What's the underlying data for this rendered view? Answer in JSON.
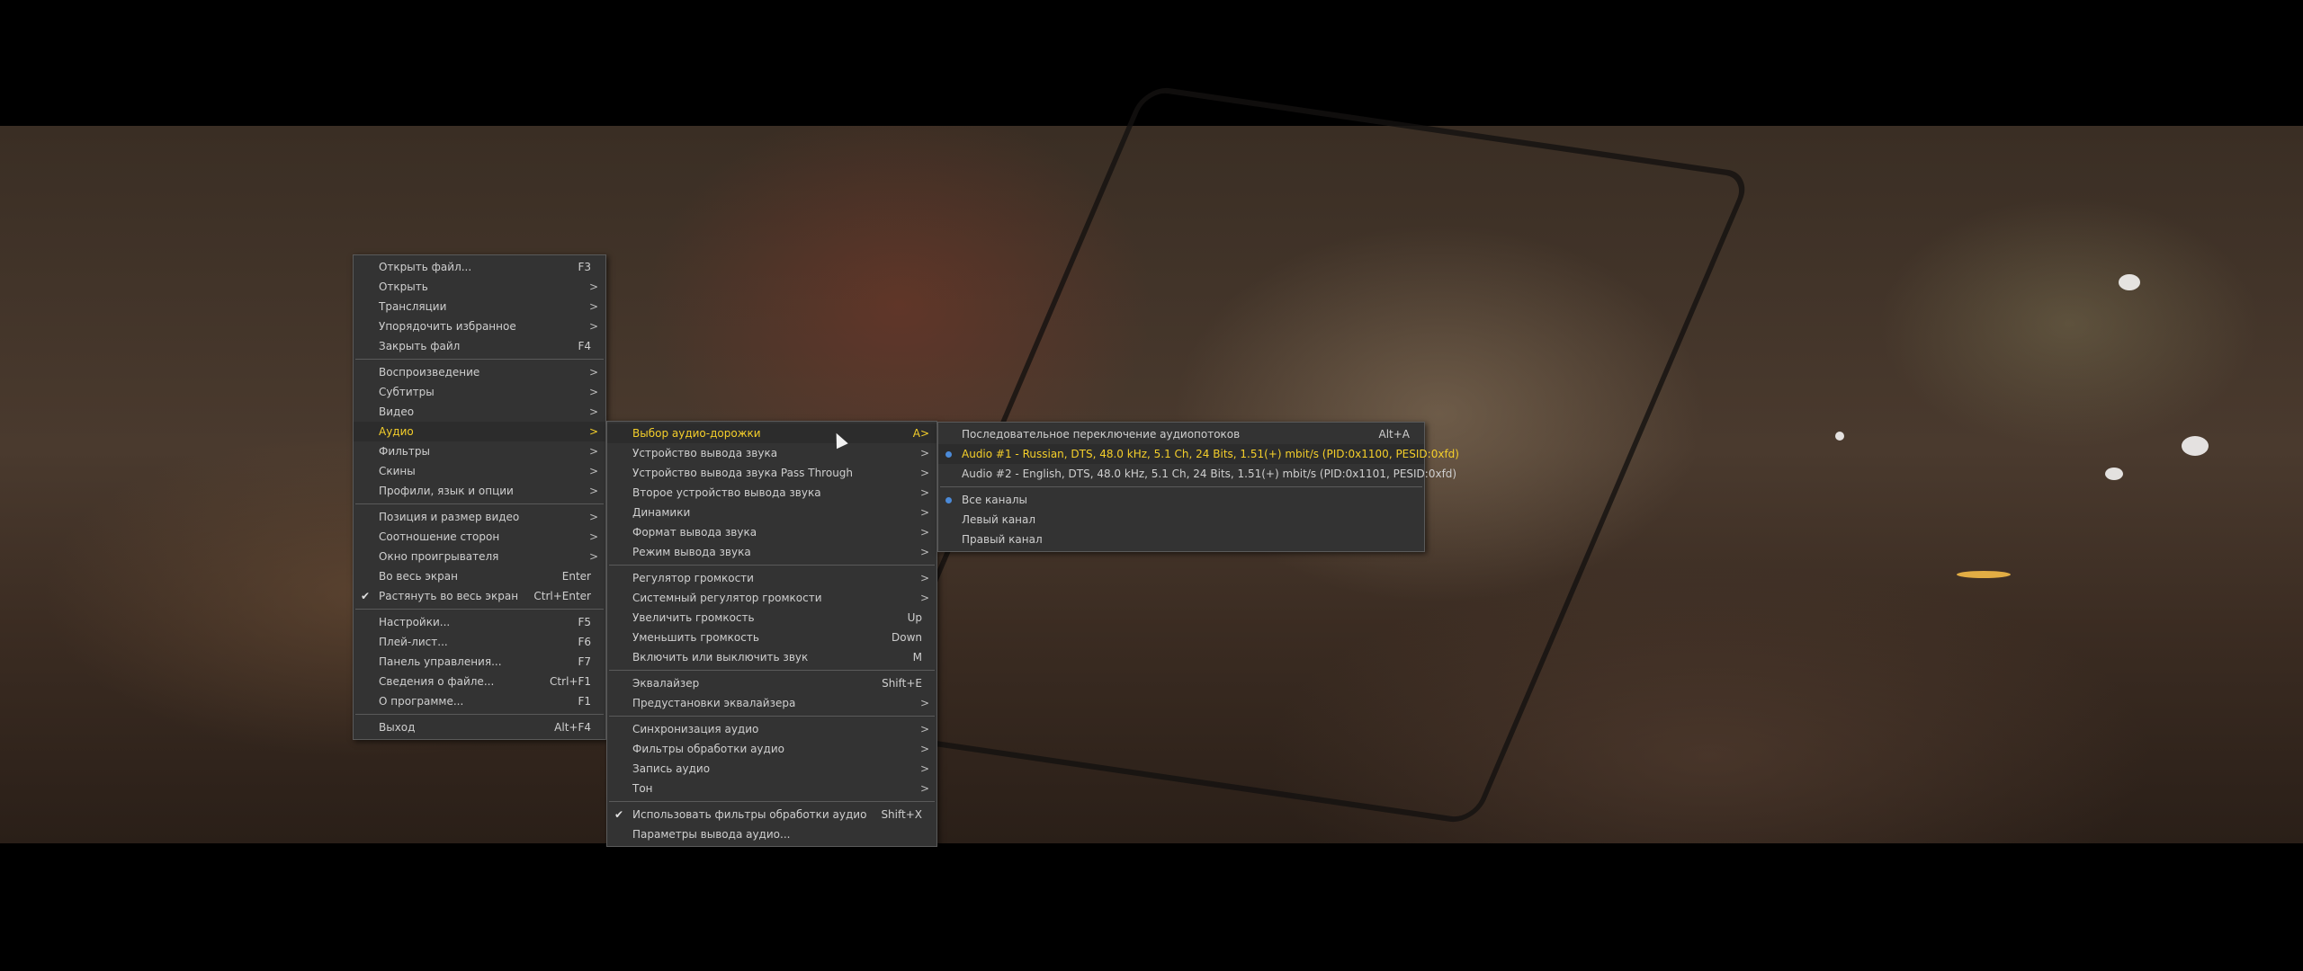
{
  "main_menu": [
    {
      "label": "Открыть файл...",
      "shortcut": "F3",
      "arrow": ""
    },
    {
      "label": "Открыть",
      "shortcut": "",
      "arrow": ">"
    },
    {
      "label": "Трансляции",
      "shortcut": "",
      "arrow": ">"
    },
    {
      "label": "Упорядочить избранное",
      "shortcut": "",
      "arrow": ">"
    },
    {
      "label": "Закрыть файл",
      "shortcut": "F4",
      "arrow": ""
    },
    {
      "label": "Воспроизведение",
      "shortcut": "",
      "arrow": ">"
    },
    {
      "label": "Субтитры",
      "shortcut": "",
      "arrow": ">"
    },
    {
      "label": "Видео",
      "shortcut": "",
      "arrow": ">"
    },
    {
      "label": "Аудио",
      "shortcut": "",
      "arrow": ">"
    },
    {
      "label": "Фильтры",
      "shortcut": "",
      "arrow": ">"
    },
    {
      "label": "Скины",
      "shortcut": "",
      "arrow": ">"
    },
    {
      "label": "Профили, язык и опции",
      "shortcut": "",
      "arrow": ">"
    },
    {
      "label": "Позиция и размер видео",
      "shortcut": "",
      "arrow": ">"
    },
    {
      "label": "Соотношение сторон",
      "shortcut": "",
      "arrow": ">"
    },
    {
      "label": "Окно проигрывателя",
      "shortcut": "",
      "arrow": ">"
    },
    {
      "label": "Во весь экран",
      "shortcut": "Enter",
      "arrow": ""
    },
    {
      "label": "Растянуть во весь экран",
      "shortcut": "Ctrl+Enter",
      "arrow": ""
    },
    {
      "label": "Настройки...",
      "shortcut": "F5",
      "arrow": ""
    },
    {
      "label": "Плей-лист...",
      "shortcut": "F6",
      "arrow": ""
    },
    {
      "label": "Панель управления...",
      "shortcut": "F7",
      "arrow": ""
    },
    {
      "label": "Сведения о файле...",
      "shortcut": "Ctrl+F1",
      "arrow": ""
    },
    {
      "label": "О программе...",
      "shortcut": "F1",
      "arrow": ""
    },
    {
      "label": "Выход",
      "shortcut": "Alt+F4",
      "arrow": ""
    }
  ],
  "audio_menu": [
    {
      "label": "Выбор аудио-дорожки",
      "shortcut": "A",
      "arrow": ">"
    },
    {
      "label": "Устройство вывода звука",
      "shortcut": "",
      "arrow": ">"
    },
    {
      "label": "Устройство вывода звука Pass Through",
      "shortcut": "",
      "arrow": ">"
    },
    {
      "label": "Второе устройство вывода звука",
      "shortcut": "",
      "arrow": ">"
    },
    {
      "label": "Динамики",
      "shortcut": "",
      "arrow": ">"
    },
    {
      "label": "Формат вывода звука",
      "shortcut": "",
      "arrow": ">"
    },
    {
      "label": "Режим вывода звука",
      "shortcut": "",
      "arrow": ">"
    },
    {
      "label": "Регулятор громкости",
      "shortcut": "",
      "arrow": ">"
    },
    {
      "label": "Системный регулятор громкости",
      "shortcut": "",
      "arrow": ">"
    },
    {
      "label": "Увеличить громкость",
      "shortcut": "Up",
      "arrow": ""
    },
    {
      "label": "Уменьшить громкость",
      "shortcut": "Down",
      "arrow": ""
    },
    {
      "label": "Включить или выключить звук",
      "shortcut": "M",
      "arrow": ""
    },
    {
      "label": "Эквалайзер",
      "shortcut": "Shift+E",
      "arrow": ""
    },
    {
      "label": "Предустановки эквалайзера",
      "shortcut": "",
      "arrow": ">"
    },
    {
      "label": "Синхронизация аудио",
      "shortcut": "",
      "arrow": ">"
    },
    {
      "label": "Фильтры обработки аудио",
      "shortcut": "",
      "arrow": ">"
    },
    {
      "label": "Запись аудио",
      "shortcut": "",
      "arrow": ">"
    },
    {
      "label": "Тон",
      "shortcut": "",
      "arrow": ">"
    },
    {
      "label": "Использовать фильтры обработки аудио",
      "shortcut": "Shift+X",
      "arrow": ""
    },
    {
      "label": "Параметры вывода аудио...",
      "shortcut": "",
      "arrow": ""
    }
  ],
  "track_menu": [
    {
      "label": "Последовательное переключение аудиопотоков",
      "shortcut": "Alt+A"
    },
    {
      "label": "Audio #1 - Russian, DTS, 48.0 kHz, 5.1 Ch, 24 Bits, 1.51(+) mbit/s (PID:0x1100, PESID:0xfd)",
      "shortcut": ""
    },
    {
      "label": "Audio #2 - English, DTS, 48.0 kHz, 5.1 Ch, 24 Bits, 1.51(+) mbit/s (PID:0x1101, PESID:0xfd)",
      "shortcut": ""
    },
    {
      "label": "Все каналы",
      "shortcut": ""
    },
    {
      "label": "Левый канал",
      "shortcut": ""
    },
    {
      "label": "Правый канал",
      "shortcut": ""
    }
  ],
  "colors": {
    "menu_bg": "#333333",
    "highlight_text": "#f5cf2a",
    "radio_dot": "#4b8ad8"
  }
}
